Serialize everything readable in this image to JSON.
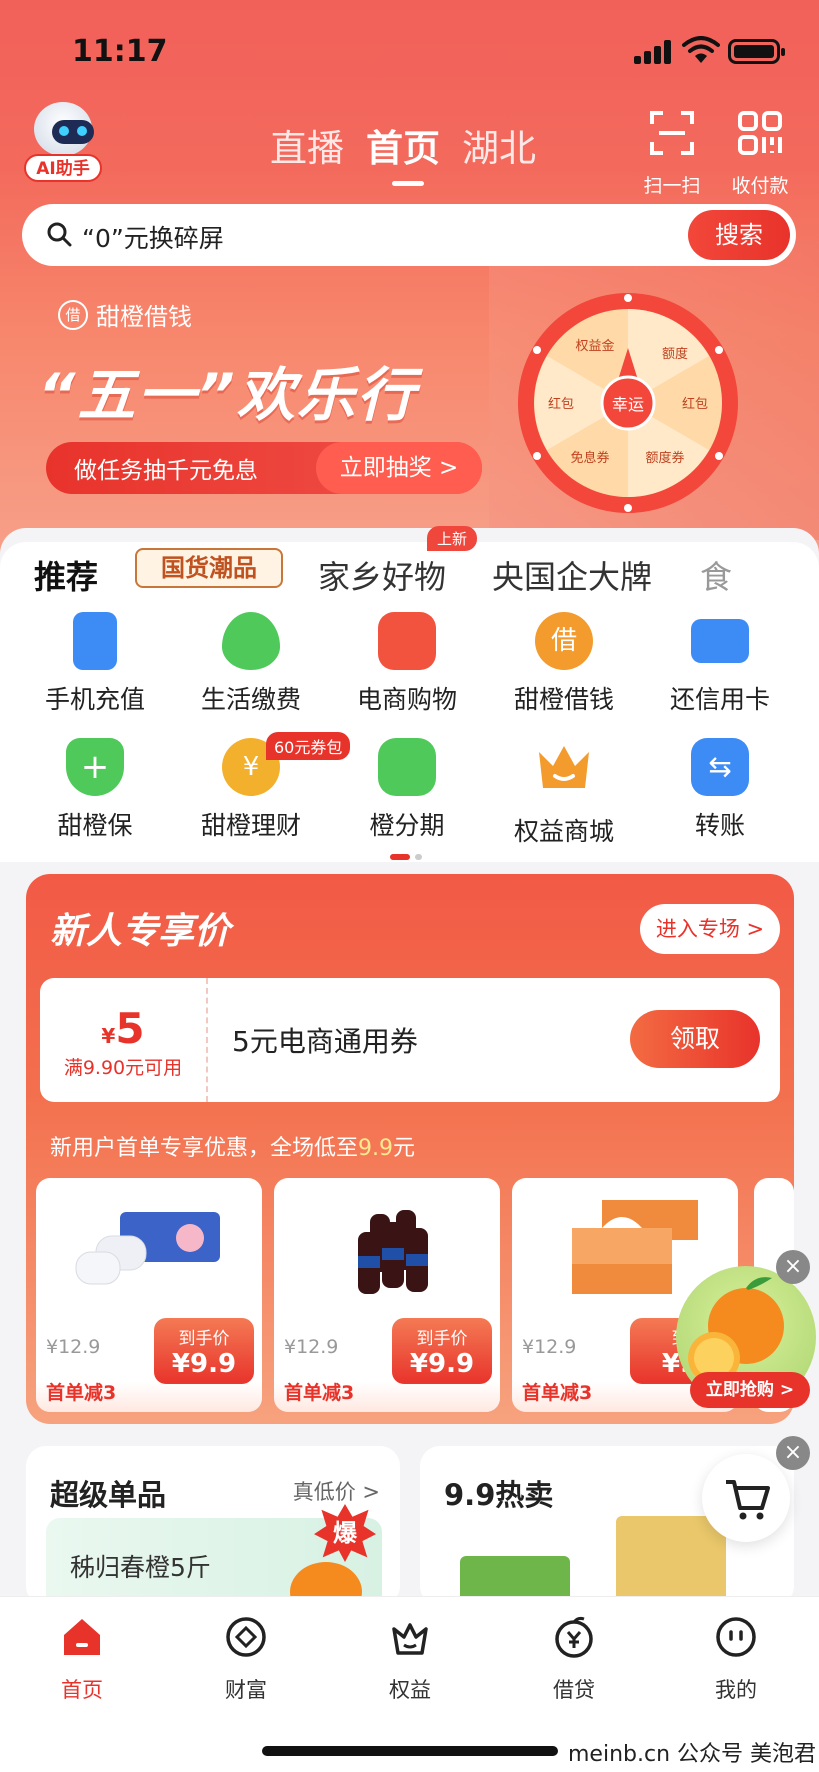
{
  "status": {
    "time": "11:17"
  },
  "header": {
    "ai_label": "AI助手",
    "tabs": [
      "直播",
      "首页",
      "湖北"
    ],
    "active_tab": 1,
    "scan_label": "扫一扫",
    "pay_label": "收付款"
  },
  "search": {
    "text": "“0”元换碎屏",
    "button": "搜索"
  },
  "banner": {
    "brand": "甜橙借钱",
    "brand_logo": "借",
    "title": "“五一”欢乐行",
    "cta_left": "做任务抽千元免息",
    "cta_right": "立即抽奖 >",
    "wheel_center": "幸运",
    "wheel_segments": [
      "权益金",
      "额度",
      "红包",
      "额度券",
      "免息券",
      "红包"
    ]
  },
  "category_tabs": {
    "items": [
      "推荐",
      "国货潮品",
      "家乡好物",
      "央国企大牌",
      "食"
    ],
    "new_badge": "上新"
  },
  "services": [
    {
      "label": "手机充值",
      "icon": "phone-icon",
      "color": "#3d8cf5"
    },
    {
      "label": "生活缴费",
      "icon": "bolt-icon",
      "color": "#4fc95a"
    },
    {
      "label": "电商购物",
      "icon": "shopping-bag-icon",
      "color": "#f2533e"
    },
    {
      "label": "甜橙借钱",
      "icon": "loan-icon",
      "color": "#f39b2c"
    },
    {
      "label": "还信用卡",
      "icon": "credit-card-icon",
      "color": "#3d8cf5"
    },
    {
      "label": "甜橙保",
      "icon": "shield-plus-icon",
      "color": "#4fc95a"
    },
    {
      "label": "甜橙理财",
      "icon": "coin-icon",
      "color": "#f3b02c"
    },
    {
      "label": "橙分期",
      "icon": "installment-icon",
      "color": "#4fc95a"
    },
    {
      "label": "权益商城",
      "icon": "crown-icon",
      "color": "#f39b2c"
    },
    {
      "label": "转账",
      "icon": "transfer-icon",
      "color": "#3d8cf5"
    }
  ],
  "services_badge": "60元券包",
  "promo": {
    "title": "新人专享价",
    "enter": "进入专场 >",
    "coupon_symbol": "¥",
    "coupon_amount": "5",
    "coupon_condition": "满9.90元可用",
    "coupon_name": "5元电商通用券",
    "coupon_button": "领取",
    "subtitle_pre": "新用户首单专享优惠，全场低至",
    "subtitle_price": "9.9",
    "subtitle_post": "元",
    "products": [
      {
        "orig": "¥12.9",
        "price_tag": "到手价",
        "price": "¥9.9",
        "discount": "首单减3"
      },
      {
        "orig": "¥12.9",
        "price_tag": "到手价",
        "price": "¥9.9",
        "discount": "首单减3"
      },
      {
        "orig": "¥12.9",
        "price_tag": "到",
        "price": "¥9",
        "discount": "首单减3"
      }
    ]
  },
  "float": {
    "button": "立即抢购 >"
  },
  "cards": [
    {
      "title": "超级单品",
      "more": "真低价 >",
      "item": "秭归春橙5斤",
      "badge": "爆"
    },
    {
      "title": "9.9热卖"
    }
  ],
  "tabbar": [
    {
      "label": "首页",
      "icon": "home-icon"
    },
    {
      "label": "财富",
      "icon": "wealth-icon"
    },
    {
      "label": "权益",
      "icon": "benefits-icon"
    },
    {
      "label": "借贷",
      "icon": "loan-yen-icon"
    },
    {
      "label": "我的",
      "icon": "profile-icon"
    }
  ],
  "watermark": "meinb.cn 公众号 美泡君",
  "colors": {
    "brand_red": "#e8332b",
    "hero_top": "#f2605a",
    "accent_yellow": "#ffe98f"
  }
}
